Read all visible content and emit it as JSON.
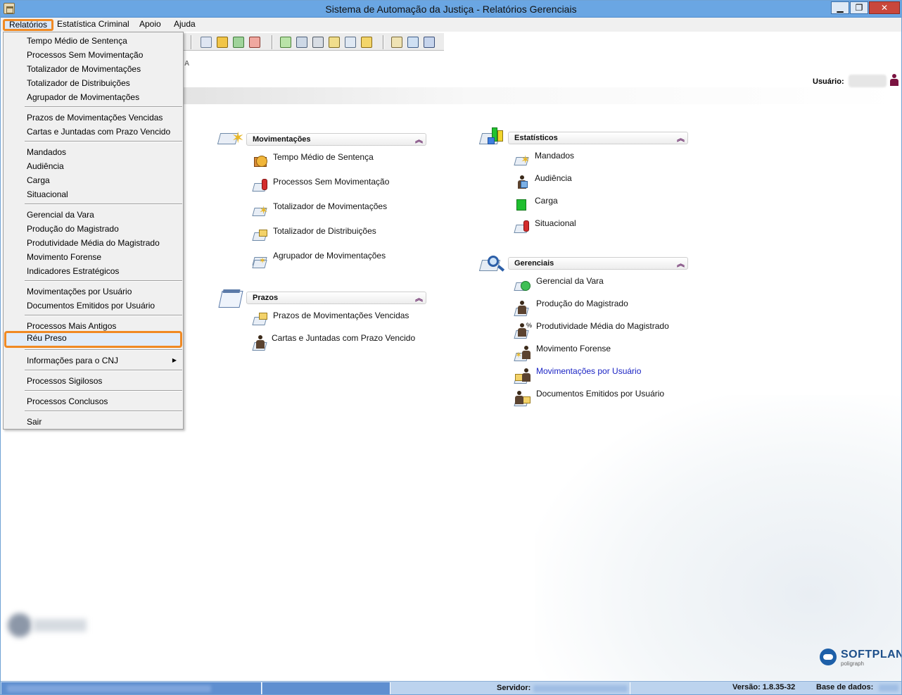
{
  "window": {
    "title": "Sistema de Automação da Justiça - Relatórios Gerenciais",
    "controls": {
      "minimize": "▁",
      "maximize": "❐",
      "close": "✕"
    }
  },
  "menubar": {
    "items": [
      "Relatórios",
      "Estatística Criminal",
      "Apoio",
      "Ajuda"
    ]
  },
  "header": {
    "letter": "A",
    "user_label": "Usuário:"
  },
  "dropdown": {
    "groups": [
      [
        "Tempo Médio de Sentença",
        "Processos Sem Movimentação",
        "Totalizador de Movimentações",
        "Totalizador de Distribuições",
        "Agrupador de Movimentações"
      ],
      [
        "Prazos de Movimentações Vencidas",
        "Cartas e Juntadas com Prazo Vencido"
      ],
      [
        "Mandados",
        "Audiência",
        "Carga",
        "Situacional"
      ],
      [
        "Gerencial da Vara",
        "Produção do Magistrado",
        "Produtividade Média do Magistrado",
        "Movimento Forense",
        "Indicadores Estratégicos"
      ],
      [
        "Movimentações por Usuário",
        "Documentos Emitidos por Usuário"
      ],
      [
        "Processos Mais Antigos",
        "Réu Preso"
      ],
      [
        "Informações para o CNJ"
      ],
      [
        "Processos Sigilosos"
      ],
      [
        "Processos Conclusos"
      ],
      [
        "Sair"
      ]
    ]
  },
  "panels": {
    "movimentacoes": {
      "title": "Movimentações",
      "items": [
        "Tempo Médio de Sentença",
        "Processos Sem Movimentação",
        "Totalizador de Movimentações",
        "Totalizador de Distribuições",
        "Agrupador de Movimentações"
      ]
    },
    "prazos": {
      "title": "Prazos",
      "items": [
        "Prazos de Movimentações Vencidas",
        "Cartas e Juntadas com Prazo Vencido"
      ]
    },
    "estatisticos": {
      "title": "Estatísticos",
      "items": [
        "Mandados",
        "Audiência",
        "Carga",
        "Situacional"
      ]
    },
    "gerenciais": {
      "title": "Gerenciais",
      "items": [
        "Gerencial da Vara",
        "Produção do Magistrado",
        "Produtividade Média do Magistrado",
        "Movimento Forense",
        "Movimentações por Usuário",
        "Documentos Emitidos por Usuário"
      ]
    },
    "collapse_glyph": "︽"
  },
  "statusbar": {
    "servidor_label": "Servidor:",
    "versao": "Versão: 1.8.35-32",
    "base_label": "Base de dados:"
  },
  "logo": {
    "name": "SOFTPLAN",
    "sub": "poligraph"
  },
  "colors": {
    "accent_orange": "#f08a24",
    "titlebar": "#6aa6e3",
    "link_blue": "#1a23c4"
  }
}
